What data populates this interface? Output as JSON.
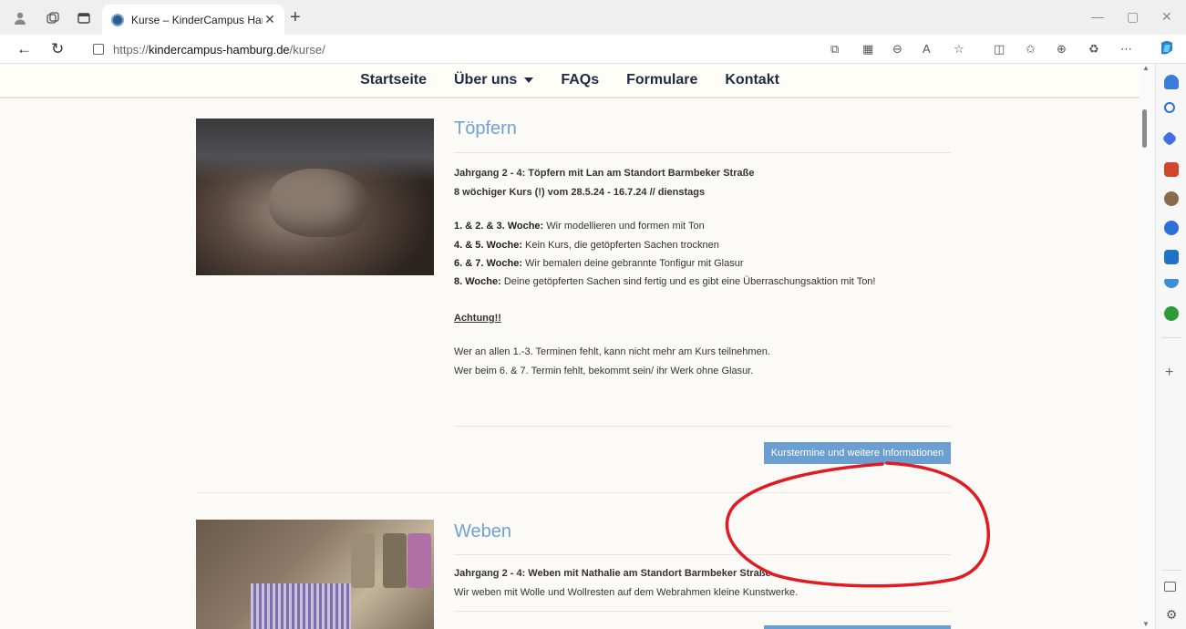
{
  "browser": {
    "tab_title": "Kurse – KinderCampus Hamburg",
    "url_prefix": "https://",
    "url_domain": "kindercampus-hamburg.de",
    "url_path": "/kurse/"
  },
  "nav": {
    "items": [
      "Startseite",
      "Über uns",
      "FAQs",
      "Formulare",
      "Kontakt"
    ]
  },
  "course1": {
    "title": "Töpfern",
    "line1": "Jahrgang 2 - 4: Töpfern mit Lan am Standort Barmbeker Straße",
    "line2": "8 wöchiger Kurs (!) vom 28.5.24 - 16.7.24 // dienstags",
    "weeks": [
      {
        "label": "1. & 2. & 3. Woche:",
        "text": " Wir modellieren und formen mit Ton"
      },
      {
        "label": "4. & 5. Woche:",
        "text": " Kein Kurs, die getöpferten Sachen trocknen"
      },
      {
        "label": "6. & 7. Woche:",
        "text": " Wir bemalen deine gebrannte Tonfigur mit Glasur"
      },
      {
        "label": "8. Woche:",
        "text": " Deine getöpferten Sachen sind fertig und es gibt eine Überraschungsaktion mit Ton!"
      }
    ],
    "warning_label": "Achtung!!",
    "warning1": "Wer an allen 1.-3. Terminen fehlt, kann nicht mehr am Kurs teilnehmen.",
    "warning2": "Wer beim 6. & 7. Termin fehlt, bekommt sein/ ihr Werk ohne Glasur.",
    "button": "Kurstermine und weitere Informationen"
  },
  "course2": {
    "title": "Weben",
    "line1": "Jahrgang 2 - 4: Weben mit Nathalie am Standort Barmbeker Straße",
    "line2": "Wir weben mit Wolle und Wollresten auf dem Webrahmen kleine Kunstwerke."
  },
  "colors": {
    "accent": "#6fa2d3",
    "button": "#6c9fd1",
    "annotation": "#e01b24",
    "nav_text": "#1f2a44"
  }
}
